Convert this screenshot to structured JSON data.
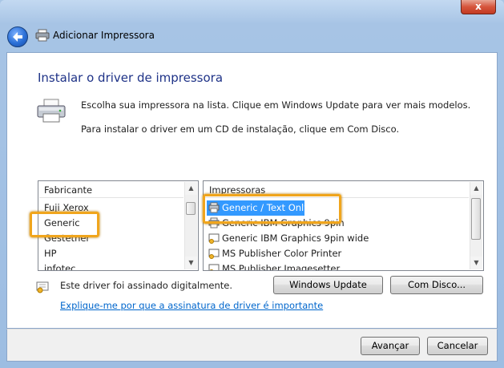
{
  "window": {
    "title": "Adicionar Impressora",
    "close_glyph": "x"
  },
  "page": {
    "heading": "Instalar o driver de impressora",
    "instruction_1": "Escolha sua impressora na lista. Clique em Windows Update para ver mais modelos.",
    "instruction_2": "Para instalar o driver em um CD de instalação, clique em Com Disco."
  },
  "manufacturers": {
    "header": "Fabricante",
    "items": [
      "Fuji Xerox",
      "Generic",
      "Gestetner",
      "HP",
      "infotec"
    ],
    "selected": "Generic"
  },
  "printers": {
    "header": "Impressoras",
    "items": [
      "Generic / Text Only",
      "Generic IBM Graphics 9pin",
      "Generic IBM Graphics 9pin wide",
      "MS Publisher Color Printer",
      "MS Publisher Imagesetter"
    ],
    "selected": "Generic / Text Only"
  },
  "signature": {
    "text": "Este driver foi assinado digitalmente.",
    "link": "Explique-me por que a assinatura de driver é importante"
  },
  "buttons": {
    "windows_update": "Windows Update",
    "have_disk": "Com Disco...",
    "next": "Avançar",
    "cancel": "Cancelar"
  },
  "icons": {
    "back": "back-arrow-icon",
    "printer": "printer-icon",
    "signed_driver": "certificate-icon"
  },
  "colors": {
    "selection": "#3399ff",
    "highlight_outline": "#f0a51c",
    "heading": "#1e3287",
    "link": "#0066cc"
  }
}
